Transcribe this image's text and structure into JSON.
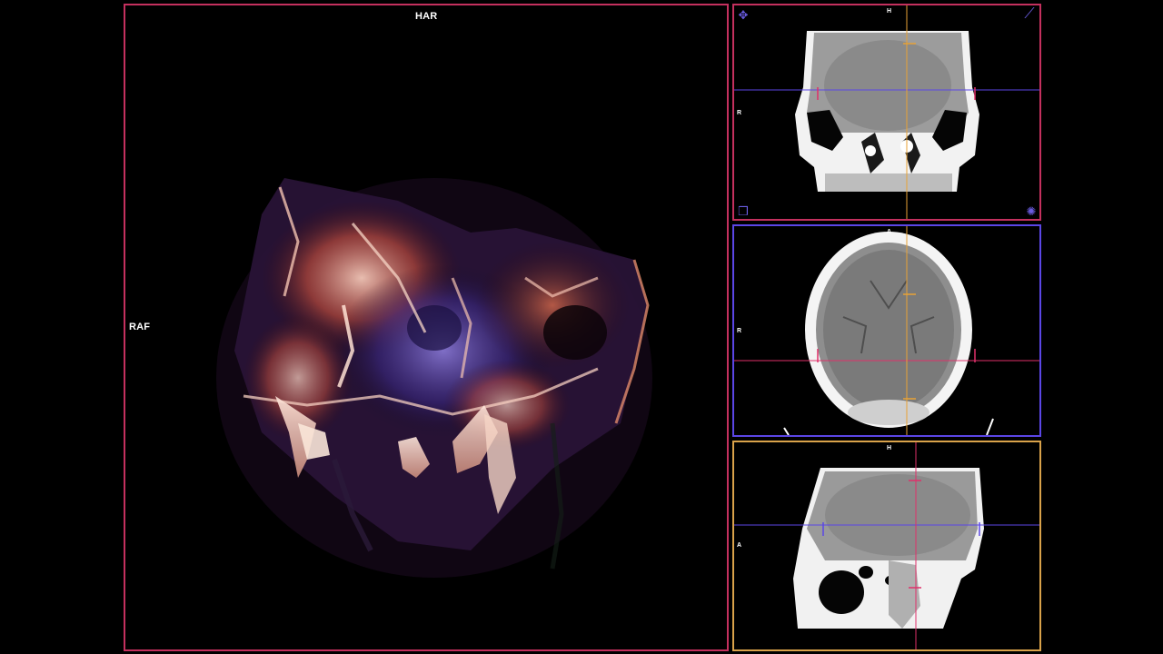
{
  "viewer": {
    "volume_view": {
      "orientation_top": "HAR",
      "orientation_left": "RAF"
    },
    "coronal_view": {
      "orientation_top": "H",
      "orientation_left": "R"
    },
    "axial_view": {
      "orientation_top": "A",
      "orientation_left": "R"
    },
    "sagittal_view": {
      "orientation_top": "H",
      "orientation_left": "A"
    },
    "icons": {
      "pan": "pan-arrows-icon",
      "measure": "ruler-icon",
      "layers": "layers-icon",
      "window_level": "brightness-icon"
    },
    "colors": {
      "volume_border": "#c4305e",
      "coronal_border": "#c4305e",
      "axial_border": "#5b46e6",
      "sagittal_border": "#d9a24a",
      "crosshair_orange": "#e8a236",
      "crosshair_pink": "#e0306a",
      "crosshair_blue": "#5b46e6"
    }
  }
}
